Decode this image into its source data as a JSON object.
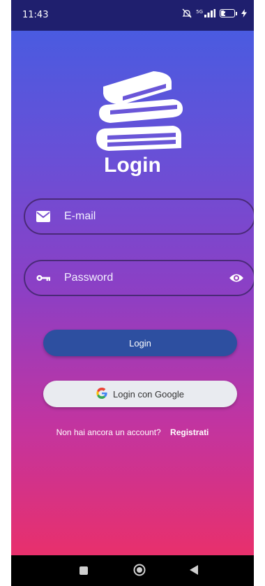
{
  "status_bar": {
    "time": "11:43",
    "network": "5G",
    "battery": "29"
  },
  "login": {
    "title": "Login",
    "email_placeholder": "E-mail",
    "password_placeholder": "Password",
    "login_button": "Login",
    "google_button": "Login con Google",
    "no_account_text": "Non hai ancora un account?",
    "register_link": "Registrati"
  },
  "icons": {
    "logo": "books-stack-icon",
    "email": "envelope-icon",
    "password": "key-icon",
    "toggle_visibility": "eye-icon",
    "google": "google-g-icon",
    "nav": [
      "square-icon",
      "circle-icon",
      "back-triangle-icon"
    ]
  },
  "colors": {
    "gradient_top": "#4a5be0",
    "gradient_bottom": "#e8306c",
    "field_border": "#4a2a78",
    "login_button": "#2d4fa0",
    "google_button": "#e9ebf0",
    "status_bar": "#1f1f6e"
  }
}
